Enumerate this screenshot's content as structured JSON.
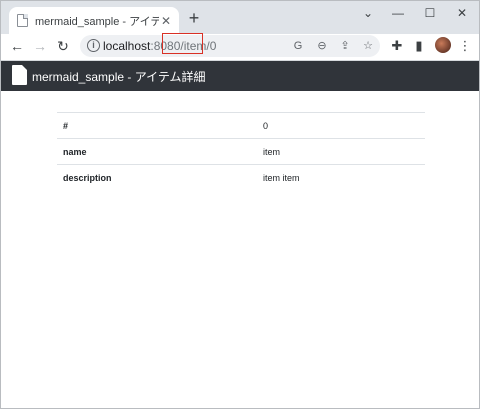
{
  "browser": {
    "tab": {
      "title": "mermaid_sample - アイテム詳細",
      "close_glyph": "✕"
    },
    "new_tab_glyph": "+",
    "window_controls": {
      "chevron": "⌄",
      "minimize": "—",
      "maximize": "☐",
      "close": "✕"
    },
    "nav": {
      "back": "←",
      "forward": "→",
      "reload": "↻"
    },
    "address": {
      "host": "localhost",
      "port": ":8080",
      "path": "/item/0"
    },
    "icons": {
      "info": "i",
      "translate": "G",
      "zoom": "⊖",
      "share": "⇪",
      "bookmark": "☆",
      "extensions": "✚",
      "side_panel": "▮",
      "menu": "⋮"
    }
  },
  "navbar": {
    "title": "mermaid_sample - アイテム詳細"
  },
  "detail": {
    "rows": [
      {
        "label": "#",
        "value": "0"
      },
      {
        "label": "name",
        "value": "item"
      },
      {
        "label": "description",
        "value": "item item"
      }
    ]
  },
  "colors": {
    "navbar_bg": "#30343a",
    "tabstrip_bg": "#dfe3e8",
    "highlight": "#d93025"
  }
}
